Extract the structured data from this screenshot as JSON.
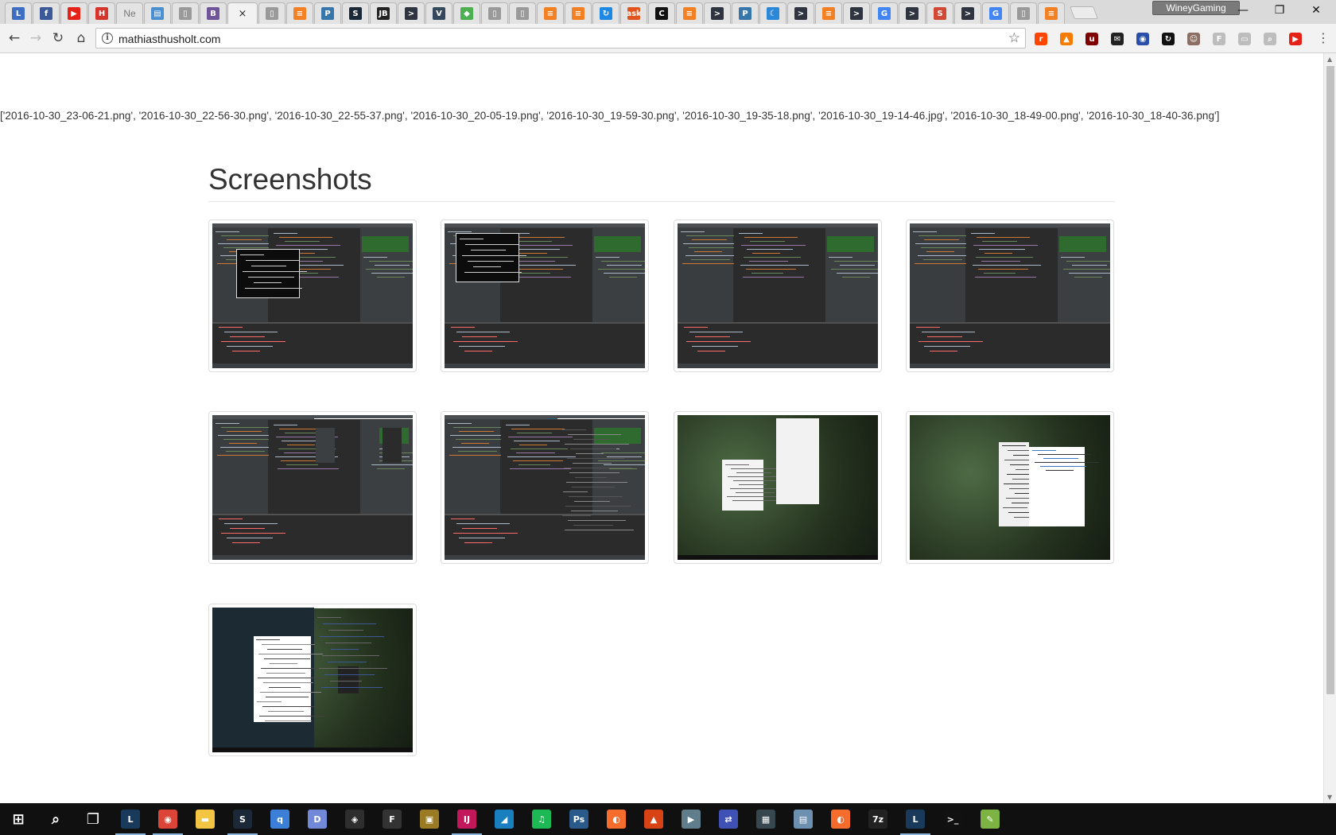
{
  "browser": {
    "tabs": [
      {
        "name": "tab-l-tutorials",
        "glyph": "L",
        "color": "#3c6fc4"
      },
      {
        "name": "tab-facebook",
        "glyph": "f",
        "color": "#3b5998"
      },
      {
        "name": "tab-youtube",
        "glyph": "▶",
        "color": "#e62117"
      },
      {
        "name": "tab-hackaday",
        "glyph": "H",
        "color": "#d6352c"
      },
      {
        "name": "tab-new",
        "glyph": "Ne",
        "color": "#777777",
        "text": true
      },
      {
        "name": "tab-clipboard",
        "glyph": "▤",
        "color": "#4b8fd0"
      },
      {
        "name": "tab-page-1",
        "glyph": "▯",
        "color": "#9a9a9a"
      },
      {
        "name": "tab-bootstrap",
        "glyph": "B",
        "color": "#6f5499"
      },
      {
        "name": "tab-active",
        "glyph": "×",
        "color": "#333333",
        "active": true
      },
      {
        "name": "tab-page-2",
        "glyph": "▯",
        "color": "#9a9a9a"
      },
      {
        "name": "tab-stackoverflow-1",
        "glyph": "≡",
        "color": "#f48024"
      },
      {
        "name": "tab-python-1",
        "glyph": "P",
        "color": "#3776ab"
      },
      {
        "name": "tab-steam",
        "glyph": "S",
        "color": "#1b2838"
      },
      {
        "name": "tab-jetbrains",
        "glyph": "JB",
        "color": "#222222"
      },
      {
        "name": "tab-terminal-1",
        "glyph": ">",
        "color": "#2e3440"
      },
      {
        "name": "tab-vue",
        "glyph": "V",
        "color": "#35495e"
      },
      {
        "name": "tab-green-app",
        "glyph": "◆",
        "color": "#4caf50"
      },
      {
        "name": "tab-page-3",
        "glyph": "▯",
        "color": "#9a9a9a"
      },
      {
        "name": "tab-page-4",
        "glyph": "▯",
        "color": "#9a9a9a"
      },
      {
        "name": "tab-stackoverflow-2",
        "glyph": "≡",
        "color": "#f48024"
      },
      {
        "name": "tab-stackoverflow-3",
        "glyph": "≡",
        "color": "#f48024"
      },
      {
        "name": "tab-sync",
        "glyph": "↻",
        "color": "#1e88e5"
      },
      {
        "name": "tab-ask",
        "glyph": "ask",
        "color": "#e2541e"
      },
      {
        "name": "tab-codecademy",
        "glyph": "C",
        "color": "#111111"
      },
      {
        "name": "tab-stackoverflow-4",
        "glyph": "≡",
        "color": "#f48024"
      },
      {
        "name": "tab-terminal-2",
        "glyph": ">",
        "color": "#2e3440"
      },
      {
        "name": "tab-python-2",
        "glyph": "P",
        "color": "#3776ab"
      },
      {
        "name": "tab-wunderlist",
        "glyph": "☾",
        "color": "#2b88d9"
      },
      {
        "name": "tab-terminal-3",
        "glyph": ">",
        "color": "#2e3440"
      },
      {
        "name": "tab-stackoverflow-5",
        "glyph": "≡",
        "color": "#f48024"
      },
      {
        "name": "tab-terminal-4",
        "glyph": ">",
        "color": "#2e3440"
      },
      {
        "name": "tab-google-1",
        "glyph": "G",
        "color": "#4285f4"
      },
      {
        "name": "tab-terminal-5",
        "glyph": ">",
        "color": "#2e3440"
      },
      {
        "name": "tab-scribd",
        "glyph": "S",
        "color": "#d14836"
      },
      {
        "name": "tab-terminal-6",
        "glyph": ">",
        "color": "#2e3440"
      },
      {
        "name": "tab-google-2",
        "glyph": "G",
        "color": "#4285f4"
      },
      {
        "name": "tab-page-5",
        "glyph": "▯",
        "color": "#9a9a9a"
      },
      {
        "name": "tab-stackoverflow-6",
        "glyph": "≡",
        "color": "#f48024"
      }
    ],
    "profile_name": "WineyGaming",
    "address": "mathiasthusholt.com",
    "extensions": [
      {
        "name": "reddit-ext-icon",
        "glyph": "r",
        "color": "#ff4500"
      },
      {
        "name": "fire-ext-icon",
        "glyph": "▲",
        "color": "#f57c00"
      },
      {
        "name": "ublock-ext-icon",
        "glyph": "u",
        "color": "#800000"
      },
      {
        "name": "mail-ext-icon",
        "glyph": "✉",
        "color": "#222222"
      },
      {
        "name": "globe-ext-icon",
        "glyph": "◉",
        "color": "#2a4fa8"
      },
      {
        "name": "sync-ext-icon",
        "glyph": "↻",
        "color": "#111111"
      },
      {
        "name": "avatar-ext-icon",
        "glyph": "☺",
        "color": "#8d6e63"
      },
      {
        "name": "f-ext-icon",
        "glyph": "F",
        "color": "#bdbdbd"
      },
      {
        "name": "tag-ext-icon",
        "glyph": "▭",
        "color": "#bdbdbd"
      },
      {
        "name": "search-ext-icon",
        "glyph": "⌕",
        "color": "#bdbdbd"
      },
      {
        "name": "youtube-ext-icon",
        "glyph": "▶",
        "color": "#e62117"
      }
    ]
  },
  "page": {
    "file_list": "['2016-10-30_23-06-21.png', '2016-10-30_22-56-30.png', '2016-10-30_22-55-37.png', '2016-10-30_20-05-19.png', '2016-10-30_19-59-30.png', '2016-10-30_19-35-18.png', '2016-10-30_19-14-46.jpg', '2016-10-30_18-49-00.png', '2016-10-30_18-40-36.png']",
    "heading": "Screenshots",
    "thumbnails": [
      {
        "kind": "ide-terminal"
      },
      {
        "kind": "ide-terminal-left"
      },
      {
        "kind": "ide"
      },
      {
        "kind": "ide-plain"
      },
      {
        "kind": "ide-browser"
      },
      {
        "kind": "ide-docs"
      },
      {
        "kind": "game-windows"
      },
      {
        "kind": "game-menu"
      },
      {
        "kind": "game-browser"
      }
    ]
  },
  "taskbar": {
    "items": [
      {
        "name": "start-button",
        "glyph": "⊞",
        "color": "#101010"
      },
      {
        "name": "search-button",
        "glyph": "⌕",
        "color": "#101010"
      },
      {
        "name": "task-view-button",
        "glyph": "❐",
        "color": "#101010"
      },
      {
        "name": "taskbar-league",
        "glyph": "L",
        "color": "#1a3a5c",
        "running": true
      },
      {
        "name": "taskbar-chrome",
        "glyph": "◉",
        "color": "#db4437",
        "running": true
      },
      {
        "name": "taskbar-explorer",
        "glyph": "▬",
        "color": "#f4c542"
      },
      {
        "name": "taskbar-steam",
        "glyph": "S",
        "color": "#1b2838",
        "running": true
      },
      {
        "name": "taskbar-qbittorrent",
        "glyph": "q",
        "color": "#3b7fd8"
      },
      {
        "name": "taskbar-discord",
        "glyph": "D",
        "color": "#7289da"
      },
      {
        "name": "taskbar-minecraft",
        "glyph": "◈",
        "color": "#2e2e2e"
      },
      {
        "name": "taskbar-app-f",
        "glyph": "F",
        "color": "#333333"
      },
      {
        "name": "taskbar-overwolf",
        "glyph": "▣",
        "color": "#9a7b24"
      },
      {
        "name": "taskbar-intellij",
        "glyph": "IJ",
        "color": "#c2185b",
        "running": true
      },
      {
        "name": "taskbar-dolphin",
        "glyph": "◢",
        "color": "#1a7fbf"
      },
      {
        "name": "taskbar-spotify",
        "glyph": "♫",
        "color": "#1db954"
      },
      {
        "name": "taskbar-ps",
        "glyph": "Ps",
        "color": "#2a5a8a"
      },
      {
        "name": "taskbar-origin",
        "glyph": "◐",
        "color": "#f56c2d"
      },
      {
        "name": "taskbar-fire",
        "glyph": "▲",
        "color": "#d84315"
      },
      {
        "name": "taskbar-player",
        "glyph": "▶",
        "color": "#607d8b"
      },
      {
        "name": "taskbar-network",
        "glyph": "⇄",
        "color": "#3f51b5"
      },
      {
        "name": "taskbar-blocks",
        "glyph": "▦",
        "color": "#37474f"
      },
      {
        "name": "taskbar-photos",
        "glyph": "▤",
        "color": "#6d8fb0"
      },
      {
        "name": "taskbar-origin-2",
        "glyph": "◐",
        "color": "#f56c2d"
      },
      {
        "name": "taskbar-7zip",
        "glyph": "7z",
        "color": "#222222"
      },
      {
        "name": "taskbar-league-2",
        "glyph": "L",
        "color": "#1a3a5c",
        "running": true
      },
      {
        "name": "taskbar-cmd",
        "glyph": ">_",
        "color": "#111111"
      },
      {
        "name": "taskbar-notepad",
        "glyph": "✎",
        "color": "#7cb342"
      }
    ],
    "ghost_text": "..."
  }
}
